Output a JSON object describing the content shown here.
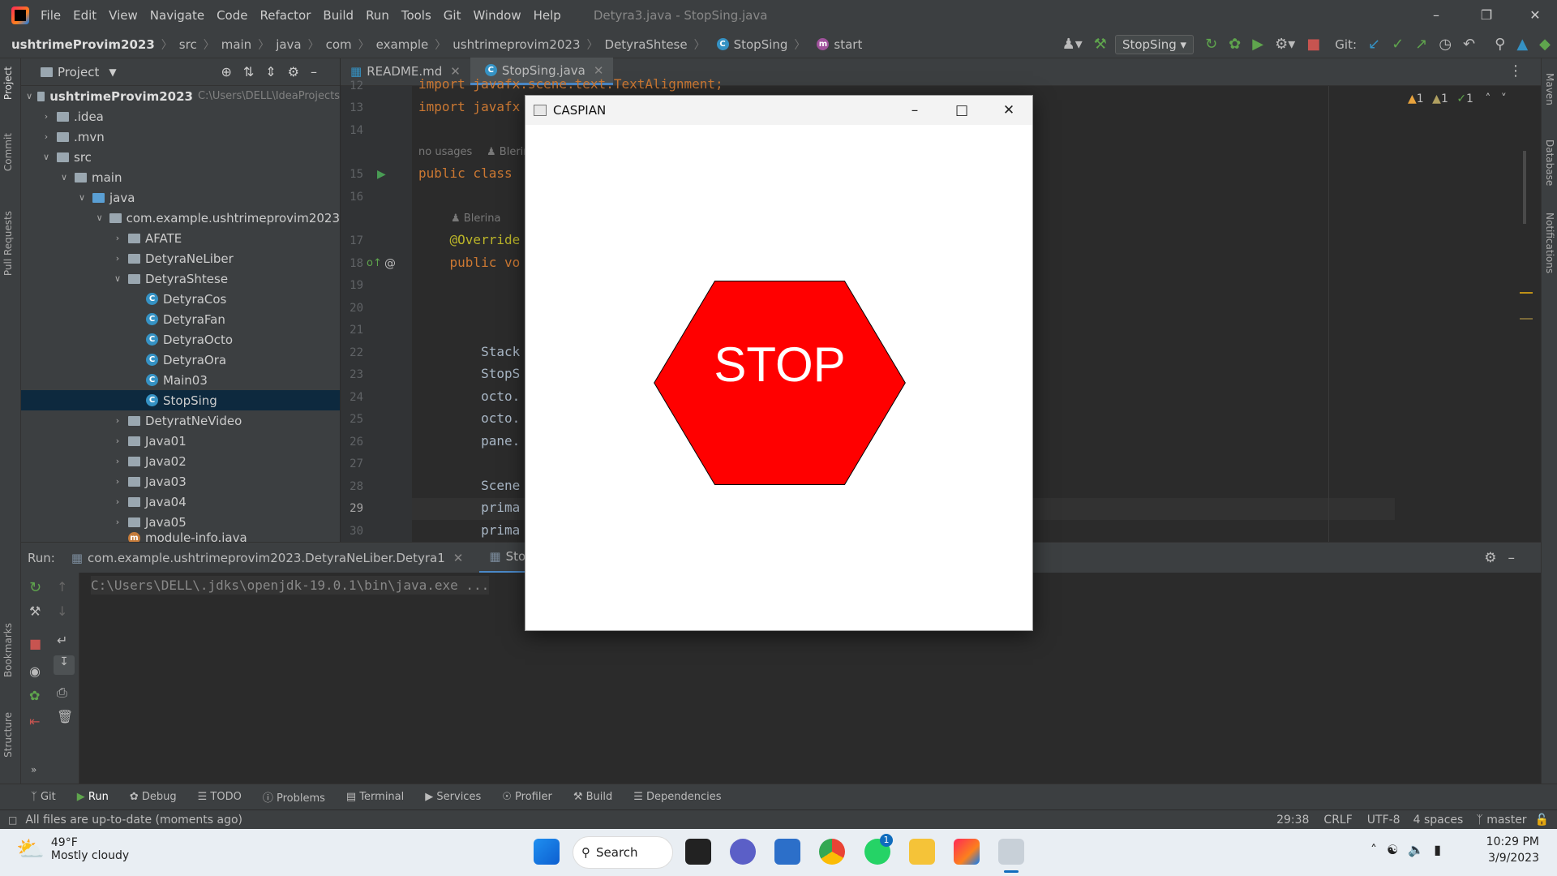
{
  "menubar": {
    "items": [
      "File",
      "Edit",
      "View",
      "Navigate",
      "Code",
      "Refactor",
      "Build",
      "Run",
      "Tools",
      "Git",
      "Window",
      "Help"
    ],
    "window_title": "Detyra3.java - StopSing.java"
  },
  "navbar": {
    "crumbs": [
      "ushtrimeProvim2023",
      "src",
      "main",
      "java",
      "com",
      "example",
      "ushtrimeprovim2023",
      "DetyraShtese",
      "StopSing",
      "start"
    ],
    "run_config": "StopSing",
    "git_label": "Git:"
  },
  "leftstrip": {
    "labels": [
      "Project",
      "Commit",
      "Pull Requests",
      "Bookmarks",
      "Structure"
    ]
  },
  "rightstrip": {
    "labels": [
      "Maven",
      "Database",
      "Notifications"
    ]
  },
  "project": {
    "header": "Project",
    "root": "ushtrimeProvim2023",
    "root_path": "C:\\Users\\DELL\\IdeaProjects",
    "nodes": [
      {
        "label": ".idea"
      },
      {
        "label": ".mvn"
      },
      {
        "label": "src"
      },
      {
        "label": "main"
      },
      {
        "label": "java"
      },
      {
        "label": "com.example.ushtrimeprovim2023"
      },
      {
        "label": "AFATE"
      },
      {
        "label": "DetyraNeLiber"
      },
      {
        "label": "DetyraShtese"
      },
      {
        "label": "DetyraCos"
      },
      {
        "label": "DetyraFan"
      },
      {
        "label": "DetyraOcto"
      },
      {
        "label": "DetyraOra"
      },
      {
        "label": "Main03"
      },
      {
        "label": "StopSing"
      },
      {
        "label": "DetyratNeVideo"
      },
      {
        "label": "Java01"
      },
      {
        "label": "Java02"
      },
      {
        "label": "Java03"
      },
      {
        "label": "Java04"
      },
      {
        "label": "Java05"
      },
      {
        "label": "module-info.java"
      }
    ]
  },
  "editor": {
    "tabs": [
      "README.md",
      "StopSing.java"
    ],
    "inspections": {
      "warn1": "1",
      "warn2": "1",
      "ok": "1"
    },
    "lines": [
      {
        "num": "12",
        "text": "import javafx.scene.text.TextAlignment;"
      },
      {
        "num": "13",
        "text": "import javafx"
      },
      {
        "num": "14",
        "text": ""
      },
      {
        "num": "15",
        "text": "public class"
      },
      {
        "num": "16",
        "text": ""
      },
      {
        "num": "17",
        "text": "    @Override"
      },
      {
        "num": "18",
        "text": "    public vo"
      },
      {
        "num": "19",
        "text": ""
      },
      {
        "num": "20",
        "text": ""
      },
      {
        "num": "21",
        "text": ""
      },
      {
        "num": "22",
        "text": "        Stack"
      },
      {
        "num": "23",
        "text": "        StopS"
      },
      {
        "num": "24",
        "text": "        octo."
      },
      {
        "num": "25",
        "text": "        octo."
      },
      {
        "num": "26",
        "text": "        pane."
      },
      {
        "num": "27",
        "text": ""
      },
      {
        "num": "28",
        "text": "        Scene"
      },
      {
        "num": "29",
        "text": "        prima"
      },
      {
        "num": "30",
        "text": "        prima"
      }
    ],
    "hints": {
      "usages": "no usages",
      "author": "Blerina",
      "author2": "Blerina"
    }
  },
  "run": {
    "label": "Run:",
    "tabs": [
      "com.example.ushtrimeprovim2023.DetyraNeLiber.Detyra1",
      "StopSing"
    ],
    "command": "C:\\Users\\DELL\\.jdks\\openjdk-19.0.1\\bin\\java.exe ..."
  },
  "toolbar": {
    "items": [
      "Git",
      "Run",
      "Debug",
      "TODO",
      "Problems",
      "Terminal",
      "Services",
      "Profiler",
      "Build",
      "Dependencies"
    ]
  },
  "status": {
    "message": "All files are up-to-date (moments ago)",
    "position": "29:38",
    "line_sep": "CRLF",
    "encoding": "UTF-8",
    "indent": "4 spaces",
    "branch": "master"
  },
  "fxwindow": {
    "title": "CASPIAN",
    "stop_text": "STOP",
    "sign_color": "#ff0000"
  },
  "taskbar": {
    "temp": "49°F",
    "weather": "Mostly cloudy",
    "search": "Search",
    "whatsapp_badge": "1",
    "time": "10:29 PM",
    "date": "3/9/2023"
  }
}
